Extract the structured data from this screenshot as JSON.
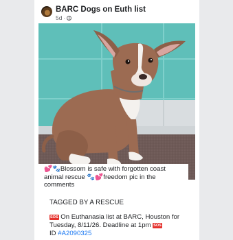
{
  "post": {
    "author": "BARC Dogs on Euth list",
    "time": "5d",
    "separator": "·",
    "privacy_icon": "globe-icon"
  },
  "photo": {
    "caption": "💕🐾Blossom is safe with forgotten coast animal rescue 🐾💕freedom pic in the comments"
  },
  "body": {
    "tag_line": "TAGGED BY A RESCUE",
    "sos_label": "SOS",
    "euth_text": "On Euthanasia list at BARC, Houston for Tuesday, 8/11/26. Deadline at 1pm",
    "id_prefix": "ID",
    "id_link": "#A2090325"
  },
  "colors": {
    "link": "#1877f2",
    "sos": "#e5322d",
    "wall": "#5fbfb9",
    "floor": "#6e5a57"
  }
}
